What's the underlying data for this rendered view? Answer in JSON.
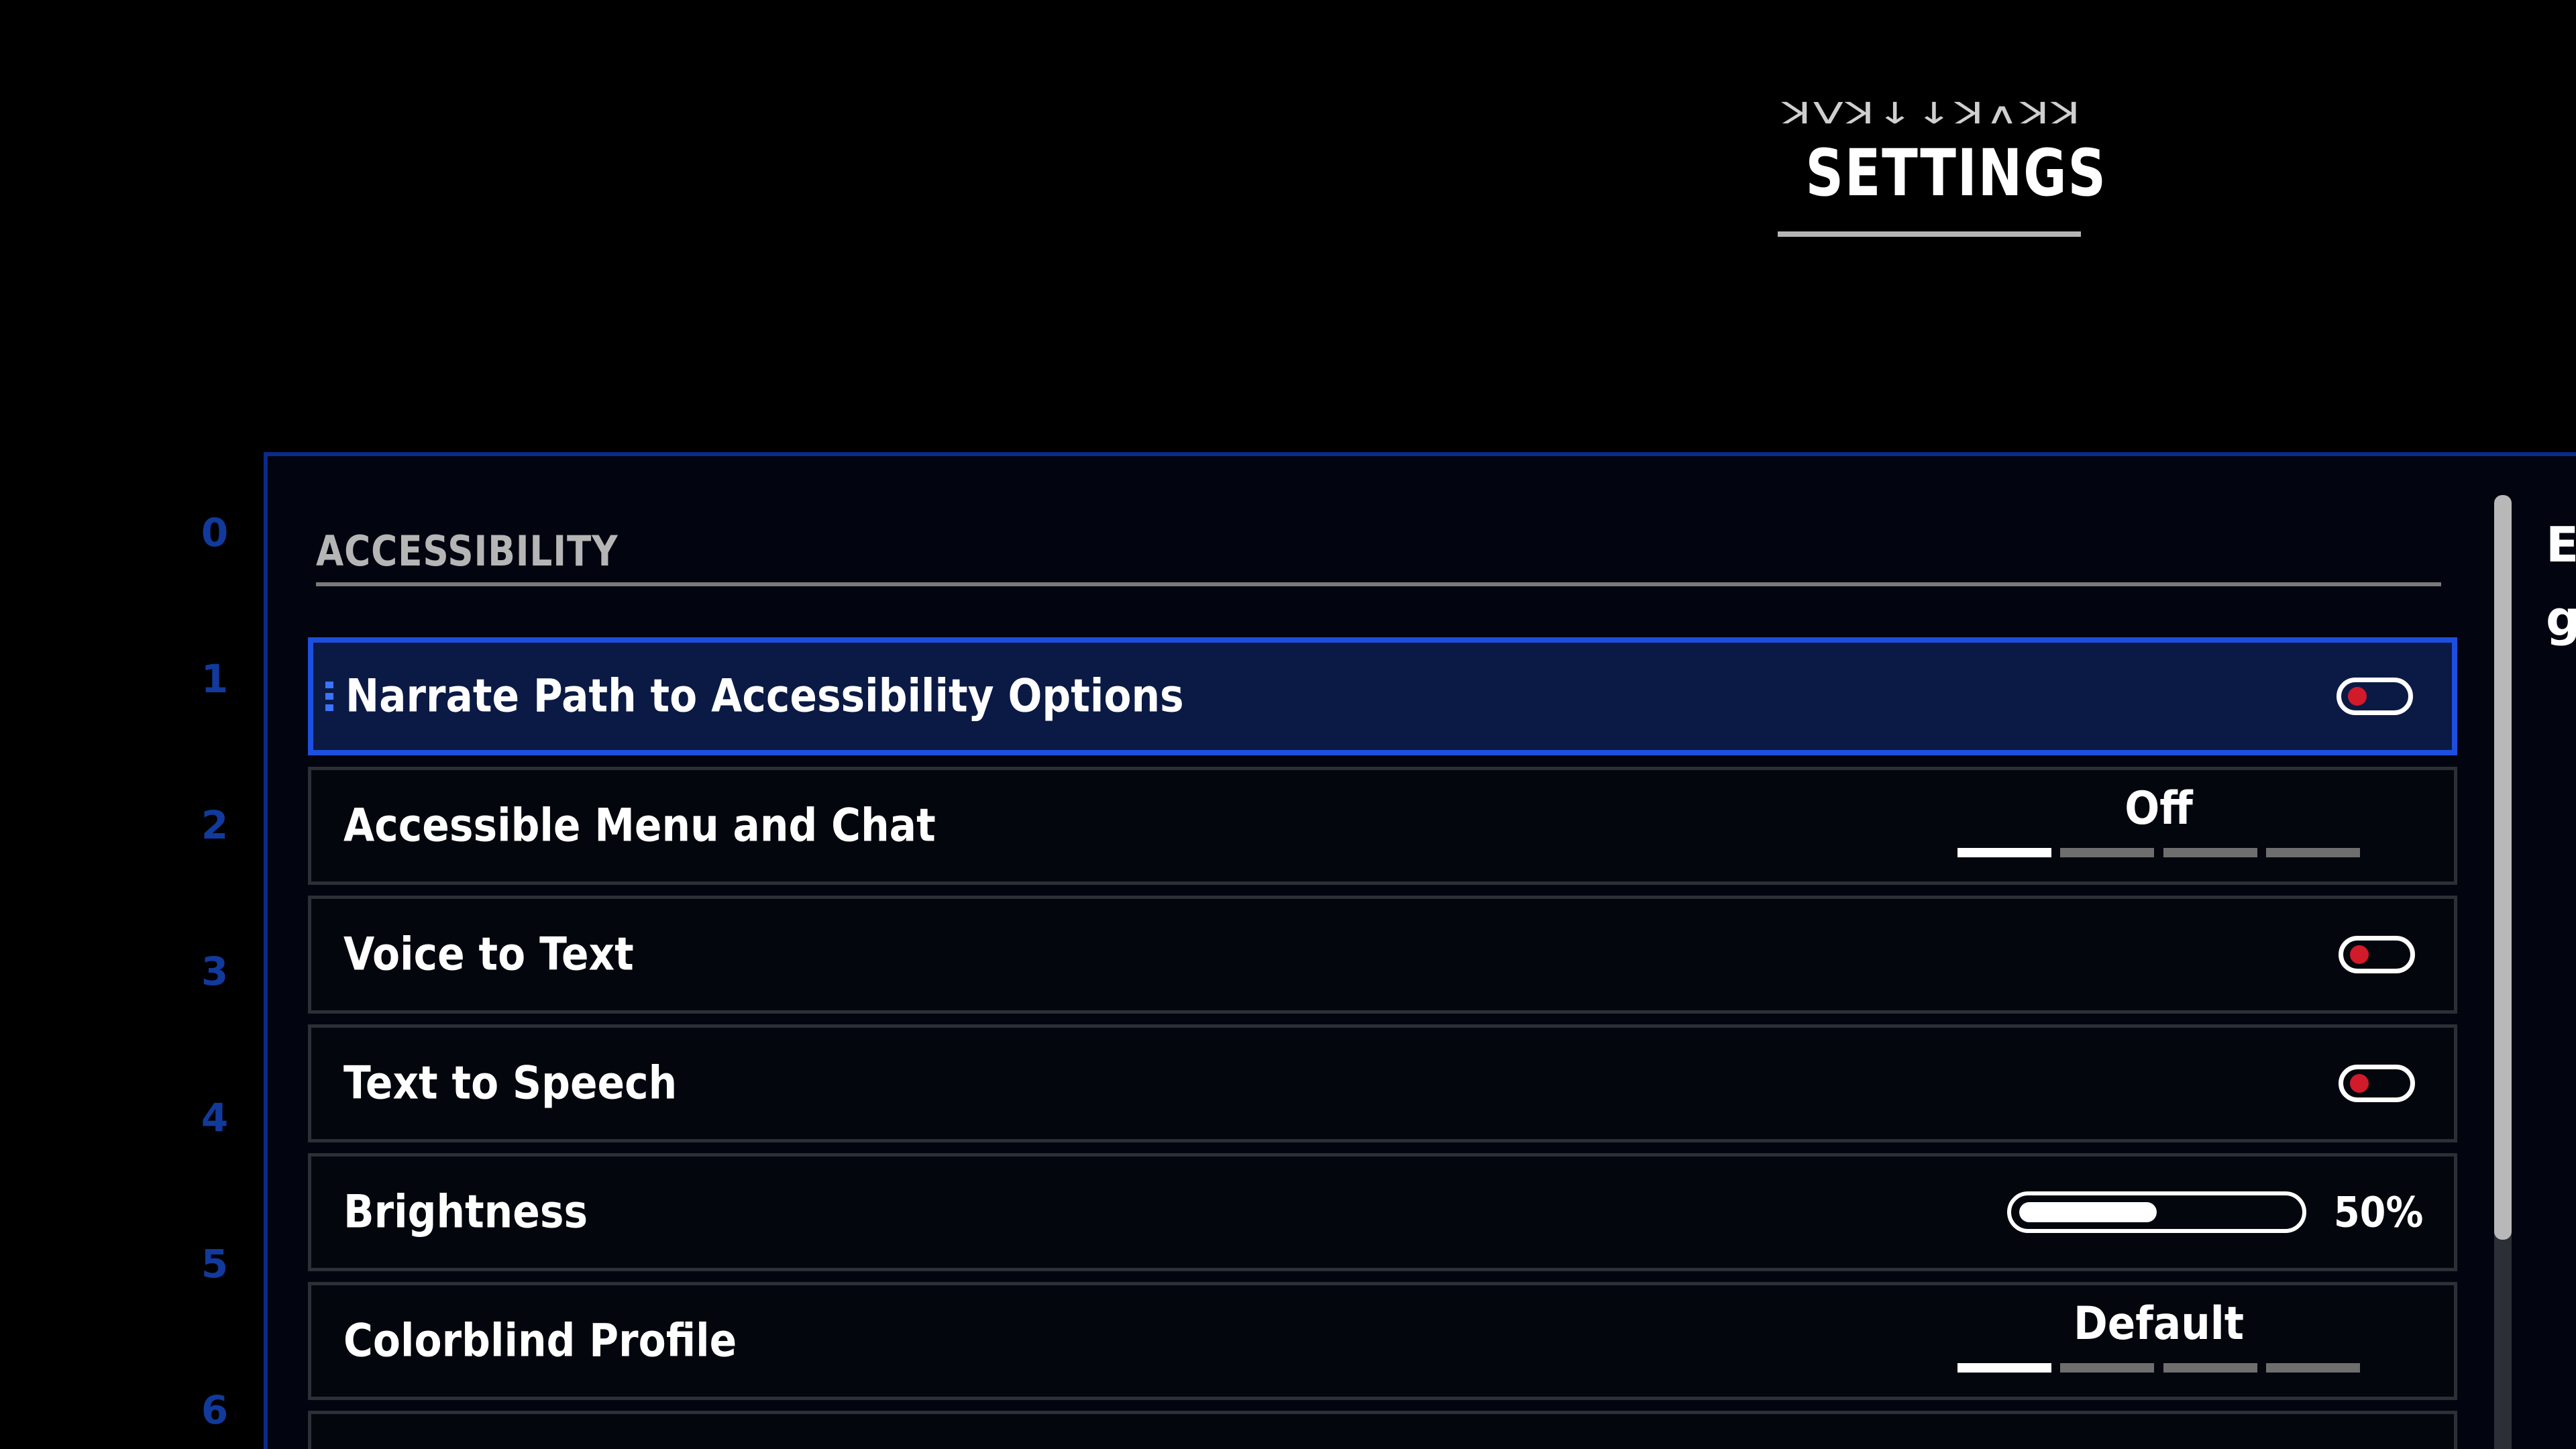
{
  "header": {
    "aurebesh": "ꓘVꓘ↓↓ꓘ∧ꓘꓘ",
    "title": "SETTINGS"
  },
  "rail": [
    "0",
    "1",
    "2",
    "3",
    "4",
    "5",
    "6"
  ],
  "section": {
    "title": "ACCESSIBILITY"
  },
  "rows": [
    {
      "label": "Narrate Path to Accessibility Options",
      "control": "toggle",
      "state": "off",
      "selected": true
    },
    {
      "label": "Accessible Menu and Chat",
      "control": "selector",
      "value": "Off",
      "options_count": 4,
      "active_index": 0
    },
    {
      "label": "Voice to Text",
      "control": "toggle",
      "state": "off"
    },
    {
      "label": "Text to Speech",
      "control": "toggle",
      "state": "off"
    },
    {
      "label": "Brightness",
      "control": "slider",
      "value_text": "50%",
      "value": 0.5
    },
    {
      "label": "Colorblind Profile",
      "control": "selector",
      "value": "Default",
      "options_count": 4,
      "active_index": 0
    }
  ],
  "side_peek": [
    "E",
    "g"
  ],
  "colors": {
    "background": "#000000",
    "panel_border": "#0b2a8a",
    "selected_border": "#1d4fdf",
    "selected_bg": "#0b1a45",
    "toggle_knob": "#d11a2a",
    "rail_text": "#123a9c"
  },
  "icons": {
    "toggle_off": "toggle-off-icon",
    "focus_marker": "focus-marker-icon"
  }
}
